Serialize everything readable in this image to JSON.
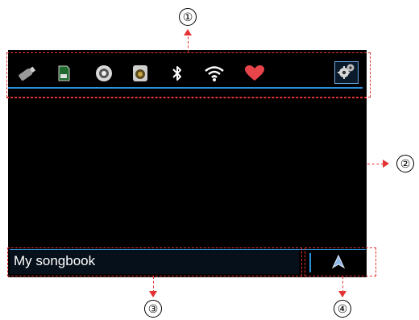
{
  "status_bar": {
    "icons": [
      {
        "name": "usb-icon"
      },
      {
        "name": "sd-card-icon"
      },
      {
        "name": "disc-icon"
      },
      {
        "name": "speaker-icon"
      },
      {
        "name": "bluetooth-icon"
      },
      {
        "name": "wifi-icon"
      },
      {
        "name": "favorite-heart-icon"
      },
      {
        "name": "settings-gears-icon"
      }
    ],
    "accent_color": "#2a8fd6",
    "heart_color": "#e8454a"
  },
  "bottom_bar": {
    "songbook_label": "My songbook"
  },
  "callouts": {
    "c1": "①",
    "c2": "②",
    "c3": "③",
    "c4": "④"
  },
  "annotation_color": "#e53333"
}
